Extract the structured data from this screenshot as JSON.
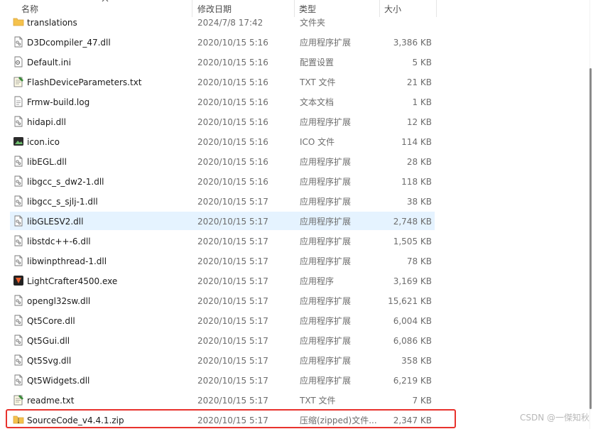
{
  "columns": {
    "name": "名称",
    "date": "修改日期",
    "type": "类型",
    "size": "大小"
  },
  "files": [
    {
      "name": "translations",
      "date": "2024/7/8 17:42",
      "type": "文件夹",
      "size": "",
      "icon": "folder-icon"
    },
    {
      "name": "D3Dcompiler_47.dll",
      "date": "2020/10/15 5:16",
      "type": "应用程序扩展",
      "size": "3,386 KB",
      "icon": "dll-file-icon"
    },
    {
      "name": "Default.ini",
      "date": "2020/10/15 5:16",
      "type": "配置设置",
      "size": "5 KB",
      "icon": "settings-file-icon"
    },
    {
      "name": "FlashDeviceParameters.txt",
      "date": "2020/10/15 5:16",
      "type": "TXT 文件",
      "size": "21 KB",
      "icon": "text-note-icon"
    },
    {
      "name": "Frmw-build.log",
      "date": "2020/10/15 5:16",
      "type": "文本文档",
      "size": "1 KB",
      "icon": "text-file-icon"
    },
    {
      "name": "hidapi.dll",
      "date": "2020/10/15 5:16",
      "type": "应用程序扩展",
      "size": "12 KB",
      "icon": "dll-file-icon"
    },
    {
      "name": "icon.ico",
      "date": "2020/10/15 5:16",
      "type": "ICO 文件",
      "size": "114 KB",
      "icon": "image-icon"
    },
    {
      "name": "libEGL.dll",
      "date": "2020/10/15 5:16",
      "type": "应用程序扩展",
      "size": "28 KB",
      "icon": "dll-file-icon"
    },
    {
      "name": "libgcc_s_dw2-1.dll",
      "date": "2020/10/15 5:16",
      "type": "应用程序扩展",
      "size": "118 KB",
      "icon": "dll-file-icon"
    },
    {
      "name": "libgcc_s_sjlj-1.dll",
      "date": "2020/10/15 5:17",
      "type": "应用程序扩展",
      "size": "38 KB",
      "icon": "dll-file-icon"
    },
    {
      "name": "libGLESV2.dll",
      "date": "2020/10/15 5:17",
      "type": "应用程序扩展",
      "size": "2,748 KB",
      "icon": "dll-file-icon",
      "hover": true
    },
    {
      "name": "libstdc++-6.dll",
      "date": "2020/10/15 5:17",
      "type": "应用程序扩展",
      "size": "1,505 KB",
      "icon": "dll-file-icon"
    },
    {
      "name": "libwinpthread-1.dll",
      "date": "2020/10/15 5:17",
      "type": "应用程序扩展",
      "size": "78 KB",
      "icon": "dll-file-icon"
    },
    {
      "name": "LightCrafter4500.exe",
      "date": "2020/10/15 5:17",
      "type": "应用程序",
      "size": "3,169 KB",
      "icon": "app-icon"
    },
    {
      "name": "opengl32sw.dll",
      "date": "2020/10/15 5:17",
      "type": "应用程序扩展",
      "size": "15,621 KB",
      "icon": "dll-file-icon"
    },
    {
      "name": "Qt5Core.dll",
      "date": "2020/10/15 5:17",
      "type": "应用程序扩展",
      "size": "6,004 KB",
      "icon": "dll-file-icon"
    },
    {
      "name": "Qt5Gui.dll",
      "date": "2020/10/15 5:17",
      "type": "应用程序扩展",
      "size": "6,086 KB",
      "icon": "dll-file-icon"
    },
    {
      "name": "Qt5Svg.dll",
      "date": "2020/10/15 5:17",
      "type": "应用程序扩展",
      "size": "358 KB",
      "icon": "dll-file-icon"
    },
    {
      "name": "Qt5Widgets.dll",
      "date": "2020/10/15 5:17",
      "type": "应用程序扩展",
      "size": "6,219 KB",
      "icon": "dll-file-icon"
    },
    {
      "name": "readme.txt",
      "date": "2020/10/15 5:17",
      "type": "TXT 文件",
      "size": "7 KB",
      "icon": "text-note-icon"
    },
    {
      "name": "SourceCode_v4.4.1.zip",
      "date": "2020/10/15 5:17",
      "type": "压缩(zipped)文件...",
      "size": "2,347 KB",
      "icon": "zip-folder-icon"
    }
  ],
  "watermark": "CSDN @一傑知秋",
  "colors": {
    "hover_row": "#e5f3ff",
    "highlight_box": "#e8322d",
    "folder": "#f5c24c"
  }
}
